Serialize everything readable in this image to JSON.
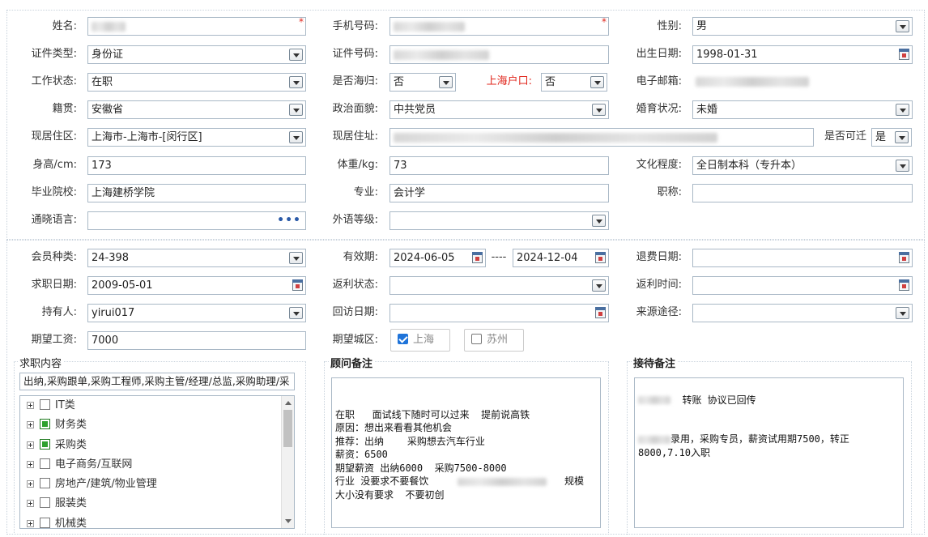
{
  "personal": {
    "name_label": "姓名:",
    "phone_label": "手机号码:",
    "gender_label": "性别:",
    "gender_value": "男",
    "id_type_label": "证件类型:",
    "id_type_value": "身份证",
    "id_number_label": "证件号码:",
    "birth_label": "出生日期:",
    "birth_value": "1998-01-31",
    "work_status_label": "工作状态:",
    "work_status_value": "在职",
    "returnee_label": "是否海归:",
    "returnee_value": "否",
    "hukou_label": "上海户口:",
    "hukou_value": "否",
    "email_label": "电子邮箱:",
    "native_label": "籍贯:",
    "native_value": "安徽省",
    "political_label": "政治面貌:",
    "political_value": "中共党员",
    "marital_label": "婚育状况:",
    "marital_value": "未婚",
    "residence_area_label": "现居住区:",
    "residence_area_value": "上海市-上海市-[闵行区]",
    "address_label": "现居住址:",
    "relocate_label": "是否可迁",
    "relocate_value": "是",
    "height_label": "身高/cm:",
    "height_value": "173",
    "weight_label": "体重/kg:",
    "weight_value": "73",
    "education_label": "文化程度:",
    "education_value": "全日制本科（专升本）",
    "school_label": "毕业院校:",
    "school_value": "上海建桥学院",
    "major_label": "专业:",
    "major_value": "会计学",
    "title_label": "职称:",
    "title_value": "",
    "language_label": "通晓语言:",
    "language_value": "",
    "foreign_level_label": "外语等级:",
    "foreign_level_value": "",
    "required_mark": "*",
    "more_icon": "•••"
  },
  "membership": {
    "member_type_label": "会员种类:",
    "member_type_value": "24-398",
    "valid_label": "有效期:",
    "valid_from": "2024-06-05",
    "valid_sep": "----",
    "valid_to": "2024-12-04",
    "refund_date_label": "退费日期:",
    "job_date_label": "求职日期:",
    "job_date_value": "2009-05-01",
    "rebate_status_label": "返利状态:",
    "rebate_time_label": "返利时间:",
    "holder_label": "持有人:",
    "holder_value": "yirui017",
    "callback_label": "回访日期:",
    "source_label": "来源途径:",
    "salary_label": "期望工资:",
    "salary_value": "7000",
    "city_label": "期望城区:",
    "city_options": [
      "上海",
      "苏州"
    ]
  },
  "job_content": {
    "title": "求职内容",
    "summary": "出纳,采购跟单,采购工程师,采购主管/经理/总监,采购助理/采",
    "tree": [
      {
        "label": "IT类",
        "checked": false
      },
      {
        "label": "财务类",
        "checked": true
      },
      {
        "label": "采购类",
        "checked": true
      },
      {
        "label": "电子商务/互联网",
        "checked": false
      },
      {
        "label": "房地产/建筑/物业管理",
        "checked": false
      },
      {
        "label": "服装类",
        "checked": false
      },
      {
        "label": "机械类",
        "checked": false
      }
    ]
  },
  "consultant_notes": {
    "title": "顾问备注",
    "line1": "在职   面试线下随时可以过来  提前说高铁",
    "line2": "原因：想出来看看其他机会",
    "line3": "推荐：出纳    采购想去汽车行业",
    "line4": "薪资：6500",
    "line5": "期望薪资 出纳6000  采购7500-8000",
    "line6a": "行业 没要求不要餐饮",
    "line6b": "规模",
    "line7": "大小没有要求  不要初创"
  },
  "reception_notes": {
    "title": "接待备注",
    "line1": "转账 协议已回传",
    "line2a": "录用，采购专员，薪资试用期7500，转正",
    "line3": "8000,7.10入职"
  }
}
